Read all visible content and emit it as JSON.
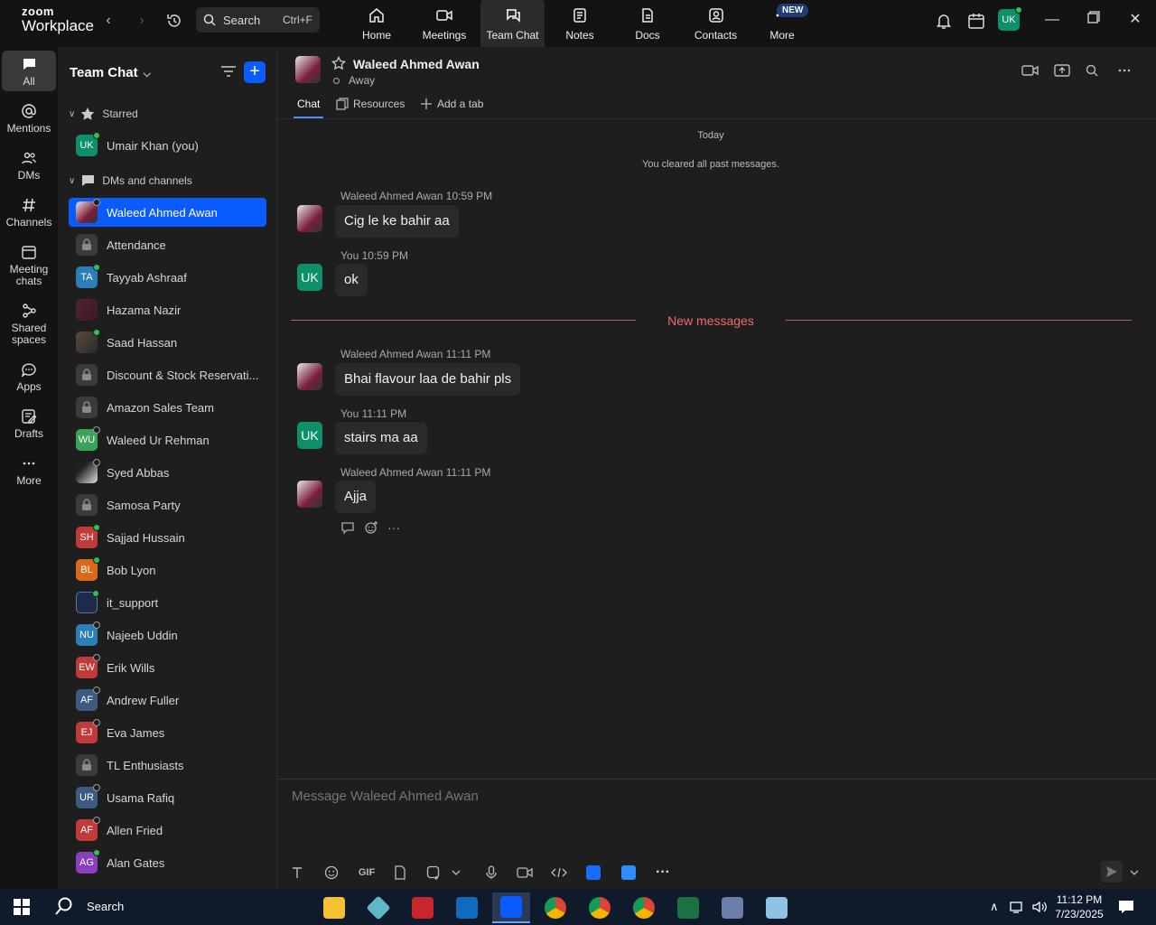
{
  "logo": {
    "line1": "zoom",
    "line2": "Workplace"
  },
  "topbar": {
    "search_label": "Search",
    "search_shortcut": "Ctrl+F",
    "tabs": [
      {
        "label": "Home",
        "icon": "home-icon"
      },
      {
        "label": "Meetings",
        "icon": "video-icon"
      },
      {
        "label": "Team Chat",
        "icon": "chat-icon"
      },
      {
        "label": "Notes",
        "icon": "notes-icon"
      },
      {
        "label": "Docs",
        "icon": "docs-icon"
      },
      {
        "label": "Contacts",
        "icon": "contacts-icon"
      },
      {
        "label": "More",
        "icon": "more-icon"
      }
    ],
    "new_badge": "NEW",
    "user_initials": "UK"
  },
  "rail": {
    "items": [
      {
        "label": "All",
        "icon": "chat-bubble-icon"
      },
      {
        "label": "Mentions",
        "icon": "at-icon"
      },
      {
        "label": "DMs",
        "icon": "people-icon"
      },
      {
        "label": "Channels",
        "icon": "hash-icon"
      },
      {
        "label": "Meeting chats",
        "icon": "calendar-icon"
      },
      {
        "label": "Shared spaces",
        "icon": "shared-icon"
      },
      {
        "label": "Apps",
        "icon": "apps-icon"
      },
      {
        "label": "Drafts",
        "icon": "drafts-icon"
      },
      {
        "label": "More",
        "icon": "ellipsis-icon"
      }
    ]
  },
  "sidebar": {
    "title": "Team Chat",
    "starred_label": "Starred",
    "dms_label": "DMs and channels",
    "starred": [
      {
        "name": "Umair Khan (you)",
        "initials": "UK",
        "color": "#0e8f6c",
        "status": "online"
      }
    ],
    "chats": [
      {
        "name": "Waleed Ahmed Awan",
        "initials": "",
        "type": "photo",
        "status": "away",
        "selected": true
      },
      {
        "name": "Attendance",
        "initials": "",
        "type": "lock",
        "status": "none"
      },
      {
        "name": "Tayyab Ashraaf",
        "initials": "TA",
        "color": "#2b7fb8",
        "status": "online"
      },
      {
        "name": "Hazama Nazir",
        "initials": "",
        "type": "photo2",
        "status": "none"
      },
      {
        "name": "Saad Hassan",
        "initials": "",
        "type": "photo3",
        "status": "online"
      },
      {
        "name": "Discount & Stock Reservati...",
        "initials": "",
        "type": "lock",
        "status": "none"
      },
      {
        "name": "Amazon Sales Team",
        "initials": "",
        "type": "lock",
        "status": "none"
      },
      {
        "name": "Waleed Ur Rehman",
        "initials": "WU",
        "color": "#3aa35a",
        "status": "away"
      },
      {
        "name": "Syed Abbas",
        "initials": "",
        "type": "photo4",
        "status": "away"
      },
      {
        "name": "Samosa Party",
        "initials": "",
        "type": "lock",
        "status": "none"
      },
      {
        "name": "Sajjad Hussain",
        "initials": "SH",
        "color": "#c23b3b",
        "status": "online"
      },
      {
        "name": "Bob Lyon",
        "initials": "BL",
        "color": "#d86a1a",
        "status": "online"
      },
      {
        "name": "it_support",
        "initials": "",
        "type": "photo5",
        "status": "online"
      },
      {
        "name": "Najeeb Uddin",
        "initials": "NU",
        "color": "#2b7fb8",
        "status": "away"
      },
      {
        "name": "Erik Wills",
        "initials": "EW",
        "color": "#c23b3b",
        "status": "away"
      },
      {
        "name": "Andrew Fuller",
        "initials": "AF",
        "color": "#3d5a80",
        "status": "away"
      },
      {
        "name": "Eva James",
        "initials": "EJ",
        "color": "#c23b3b",
        "status": "away"
      },
      {
        "name": "TL Enthusiasts",
        "initials": "",
        "type": "lock",
        "status": "none"
      },
      {
        "name": "Usama Rafiq",
        "initials": "UR",
        "color": "#3d5a80",
        "status": "away"
      },
      {
        "name": "Allen Fried",
        "initials": "AF",
        "color": "#c23b3b",
        "status": "away"
      },
      {
        "name": "Alan Gates",
        "initials": "AG",
        "color": "#8a3fbf",
        "status": "online"
      }
    ]
  },
  "chat": {
    "contact_name": "Waleed Ahmed Awan",
    "contact_status": "Away",
    "tabs": [
      {
        "label": "Chat"
      },
      {
        "label": "Resources"
      },
      {
        "label": "Add a tab"
      }
    ],
    "today_label": "Today",
    "cleared_label": "You cleared all past messages.",
    "new_messages_label": "New messages",
    "messages": [
      {
        "sender": "Waleed Ahmed Awan",
        "time": "10:59 PM",
        "text": "Cig le ke bahir aa",
        "mine": false
      },
      {
        "sender": "You",
        "time": "10:59 PM",
        "text": "ok",
        "mine": true
      },
      {
        "sender": "Waleed Ahmed Awan",
        "time": "11:11 PM",
        "text": "Bhai flavour laa de bahir pls",
        "mine": false
      },
      {
        "sender": "You",
        "time": "11:11 PM",
        "text": "stairs ma aa",
        "mine": true
      },
      {
        "sender": "Waleed Ahmed Awan",
        "time": "11:11 PM",
        "text": "Ajja",
        "mine": false
      }
    ],
    "my_initials": "UK",
    "composer_placeholder": "Message Waleed Ahmed Awan",
    "gif_label": "GIF"
  },
  "taskbar": {
    "search_label": "Search",
    "time": "11:12 PM",
    "date": "7/23/2025"
  },
  "colors": {
    "accent": "#0b5cff",
    "online": "#2ac34f",
    "new_messages": "#ef6b6b"
  }
}
